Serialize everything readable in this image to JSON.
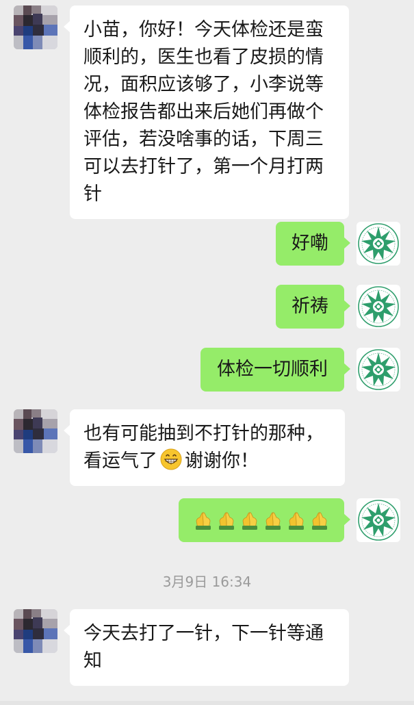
{
  "app": {
    "name": "WeChat chat"
  },
  "colors": {
    "background": "#ededed",
    "incoming_bubble": "#ffffff",
    "outgoing_bubble": "#95ec69",
    "text": "#191919",
    "timestamp": "#9a9a9a"
  },
  "messages": [
    {
      "direction": "incoming",
      "text": "小苗，你好！今天体检还是蛮顺利的，医生也看了皮损的情况，面积应该够了，小李说等体检报告都出来后她们再做个评估，若没啥事的话，下周三可以去打针了，第一个月打两针",
      "avatar": "pixelated-avatar-icon"
    },
    {
      "direction": "outgoing",
      "text": "好嘞",
      "avatar": "green-star-logo-avatar"
    },
    {
      "direction": "outgoing",
      "text": "祈祷",
      "avatar": "green-star-logo-avatar"
    },
    {
      "direction": "outgoing",
      "text": "体检一切顺利",
      "avatar": "green-star-logo-avatar"
    },
    {
      "direction": "incoming",
      "text_part1": "也有可能抽到不打针的那种，看运气了",
      "emoji": "grinning-face-icon",
      "text_part2": "谢谢你！",
      "avatar": "pixelated-avatar-icon"
    },
    {
      "direction": "outgoing",
      "emoji_sequence": [
        "pray-icon",
        "pray-icon",
        "pray-icon",
        "pray-icon",
        "pray-icon",
        "pray-icon"
      ],
      "avatar": "green-star-logo-avatar"
    },
    {
      "direction": "incoming",
      "text": "今天去打了一针，下一针等通知",
      "avatar": "pixelated-avatar-icon"
    }
  ],
  "timestamp": "3月9日 16:34"
}
